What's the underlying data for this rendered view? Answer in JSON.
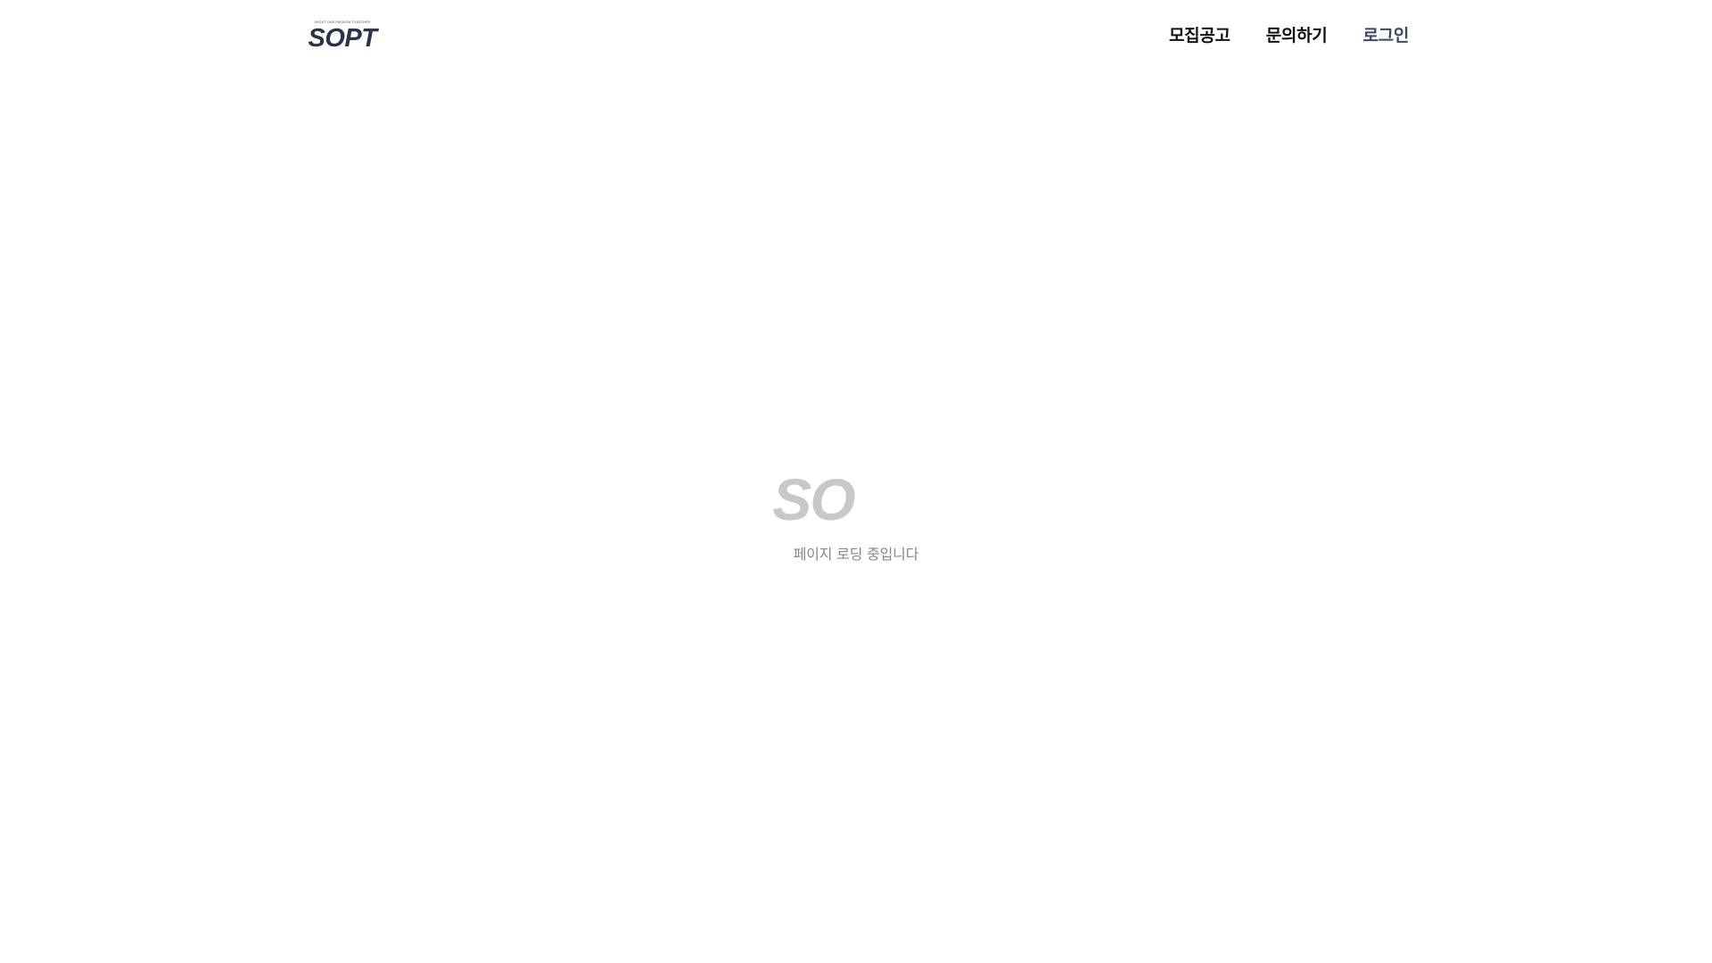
{
  "header": {
    "logo": {
      "wordmark": "SOPT",
      "tagline": "SHOUT OUR PASSION TOGETHER",
      "color": "#2b3447"
    },
    "nav": {
      "items": [
        {
          "label": "모집공고",
          "color": "#111111"
        },
        {
          "label": "문의하기",
          "color": "#111111"
        },
        {
          "label": "로그인",
          "color": "#3a4863"
        }
      ]
    }
  },
  "loader": {
    "logo_letters": "SO",
    "logo_color": "#c8c8c8",
    "message": "페이지 로딩 중입니다"
  }
}
